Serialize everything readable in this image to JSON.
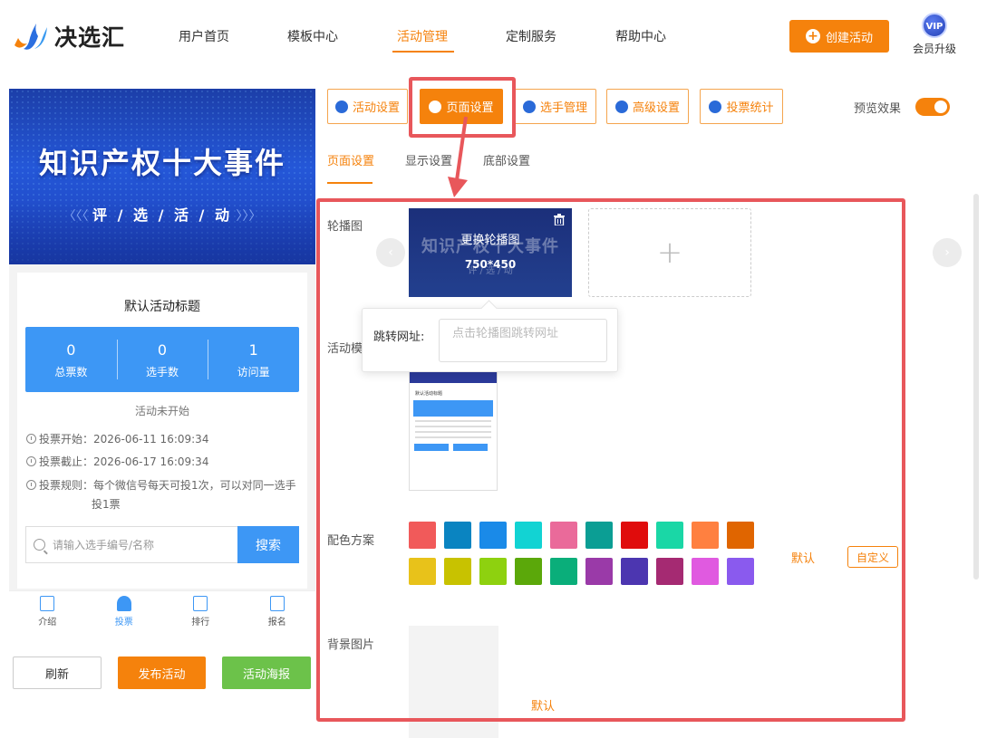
{
  "brand": {
    "name": "决选汇"
  },
  "nav": {
    "items": [
      "用户首页",
      "模板中心",
      "活动管理",
      "定制服务",
      "帮助中心"
    ],
    "active": "活动管理",
    "create_label": "创建活动",
    "vip_badge": "VIP",
    "vip_label": "会员升级"
  },
  "preview": {
    "banner_title": "知识产权十大事件",
    "banner_sub": "评 / 选 / 活 / 动",
    "activity_title": "默认活动标题",
    "stats": [
      {
        "value": "0",
        "label": "总票数"
      },
      {
        "value": "0",
        "label": "选手数"
      },
      {
        "value": "1",
        "label": "访问量"
      }
    ],
    "status": "活动未开始",
    "vote_start": "投票开始：2026-06-11 16:09:34",
    "vote_end": "投票截止：2026-06-17 16:09:34",
    "vote_rule_1": "投票规则：每个微信号每天可投1次，可以对同一选手",
    "vote_rule_2": "投1票",
    "search_placeholder": "请输入选手编号/名称",
    "search_button": "搜索",
    "tabs": [
      "介绍",
      "投票",
      "排行",
      "报名"
    ],
    "active_tab": "投票"
  },
  "actions": {
    "refresh": "刷新",
    "publish": "发布活动",
    "poster": "活动海报"
  },
  "tools": {
    "activity_settings": "活动设置",
    "page_settings": "页面设置",
    "player_management": "选手管理",
    "advanced_settings": "高级设置",
    "vote_stats": "投票统计",
    "preview_label": "预览效果",
    "preview_on": true
  },
  "subtabs": [
    "页面设置",
    "显示设置",
    "底部设置"
  ],
  "form": {
    "carousel_label": "轮播图",
    "carousel_replace": "更换轮播图",
    "carousel_size": "750*450",
    "carousel_bg_title": "知识产权十大事件",
    "carousel_bg_sub": "评 / 选 / 动",
    "add_symbol": "+",
    "jump_label": "跳转网址:",
    "jump_placeholder": "点击轮播图跳转网址",
    "template_label": "活动模",
    "template_thumb_title": "默认活动标题",
    "color_label": "配色方案",
    "colors": [
      "#f15a5a",
      "#0a84c1",
      "#1a8ae8",
      "#12d3d3",
      "#ea6a9a",
      "#0b9e94",
      "#e00c0c",
      "#1ad7a6",
      "#ff8040",
      "#e06500",
      "#e8c21a",
      "#c8c200",
      "#8ed10f",
      "#5ba80a",
      "#0aae7a",
      "#9a3aa8",
      "#4c36b0",
      "#a52a72",
      "#e05ae0",
      "#8a5aee"
    ],
    "color_default": "默认",
    "color_custom": "自定义",
    "bg_label": "背景图片",
    "bg_default": "默认"
  }
}
